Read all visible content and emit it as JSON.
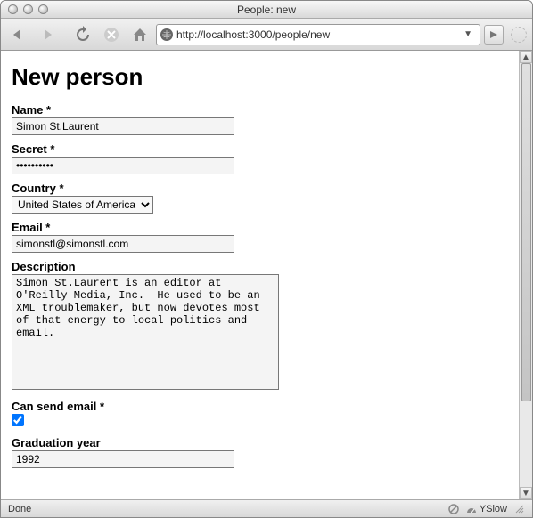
{
  "window": {
    "title": "People: new"
  },
  "toolbar": {
    "url": "http://localhost:3000/people/new"
  },
  "page": {
    "heading": "New person",
    "fields": {
      "name": {
        "label": "Name *",
        "value": "Simon St.Laurent"
      },
      "secret": {
        "label": "Secret *",
        "value": "**********"
      },
      "country": {
        "label": "Country *",
        "selected": "United States of America"
      },
      "email": {
        "label": "Email *",
        "value": "simonstl@simonstl.com"
      },
      "description": {
        "label": "Description",
        "value": "Simon St.Laurent is an editor at O'Reilly Media, Inc.  He used to be an XML troublemaker, but now devotes most of that energy to local politics and email."
      },
      "can_send_email": {
        "label": "Can send email *",
        "checked": true
      },
      "graduation_year": {
        "label": "Graduation year",
        "value": "1992"
      }
    }
  },
  "statusbar": {
    "status": "Done",
    "yslow": "YSlow"
  }
}
